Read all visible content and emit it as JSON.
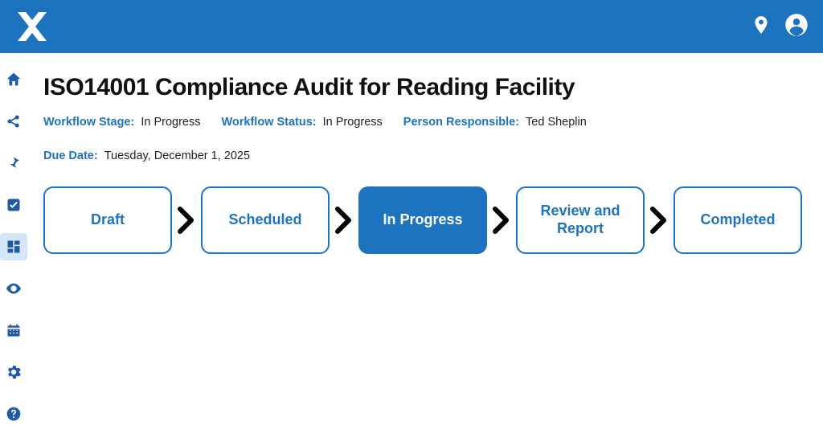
{
  "page": {
    "title": "ISO14001 Compliance Audit for Reading Facility"
  },
  "meta": {
    "stage_label": "Workflow Stage:",
    "stage_value": "In Progress",
    "status_label": "Workflow Status:",
    "status_value": "In Progress",
    "person_label": "Person Responsible:",
    "person_value": "Ted Sheplin",
    "due_label": "Due Date:",
    "due_value": "Tuesday, December 1,  2025"
  },
  "stages": {
    "s0": "Draft",
    "s1": "Scheduled",
    "s2": "In Progress",
    "s3": "Review and Report",
    "s4": "Completed",
    "active_index": 2
  }
}
